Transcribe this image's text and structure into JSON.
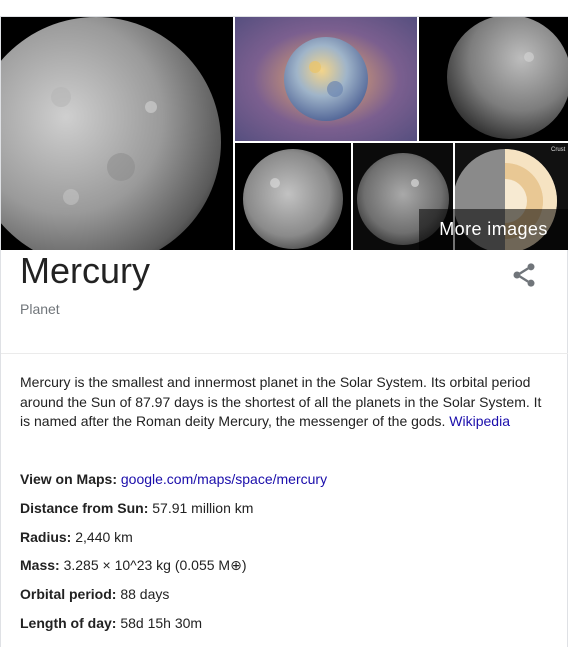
{
  "gallery": {
    "more_images_label": "More images",
    "image_labels": [
      "Crust"
    ]
  },
  "entity": {
    "title": "Mercury",
    "subtitle": "Planet"
  },
  "description": {
    "text": "Mercury is the smallest and innermost planet in the Solar System. Its orbital period around the Sun of 87.97 days is the shortest of all the planets in the Solar System. It is named after the Roman deity Mercury, the messenger of the gods.",
    "source_link": "Wikipedia"
  },
  "facts": [
    {
      "label": "View on Maps:",
      "value": "google.com/maps/space/mercury",
      "link": true
    },
    {
      "label": "Distance from Sun:",
      "value": "57.91 million km"
    },
    {
      "label": "Radius:",
      "value": "2,440 km"
    },
    {
      "label": "Mass:",
      "value": "3.285 × 10^23 kg (0.055 M⊕)"
    },
    {
      "label": "Orbital period:",
      "value": "88 days"
    },
    {
      "label": "Length of day:",
      "value": "58d 15h 30m"
    }
  ],
  "colors": {
    "link": "#1a0dab",
    "text": "#222222",
    "secondary": "#70757a"
  },
  "icons": [
    "share-icon"
  ]
}
